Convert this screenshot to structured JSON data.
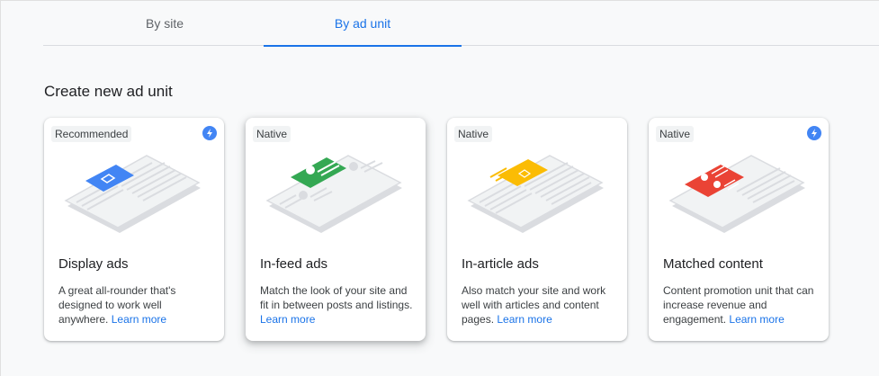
{
  "tabs": [
    {
      "label": "By site",
      "active": false
    },
    {
      "label": "By ad unit",
      "active": true
    }
  ],
  "section_title": "Create new ad unit",
  "colors": {
    "accent": "#1a73e8",
    "bolt": "#4285f4",
    "display": "#4285f4",
    "infeed": "#34a853",
    "inarticle": "#fbbc04",
    "matched": "#ea4335"
  },
  "cards": [
    {
      "chip": "Recommended",
      "bolt": true,
      "icon": "display-ad-illustration",
      "title": "Display ads",
      "desc": "A great all-rounder that's designed to work well anywhere.",
      "link": "Learn more"
    },
    {
      "chip": "Native",
      "bolt": false,
      "icon": "in-feed-ad-illustration",
      "title": "In-feed ads",
      "desc": "Match the look of your site and fit in between posts and listings.",
      "link": "Learn more"
    },
    {
      "chip": "Native",
      "bolt": false,
      "icon": "in-article-ad-illustration",
      "title": "In-article ads",
      "desc": "Also match your site and work well with articles and content pages.",
      "link": "Learn more"
    },
    {
      "chip": "Native",
      "bolt": true,
      "icon": "matched-content-illustration",
      "title": "Matched content",
      "desc": "Content promotion unit that can increase revenue and engagement.",
      "link": "Learn more"
    }
  ]
}
